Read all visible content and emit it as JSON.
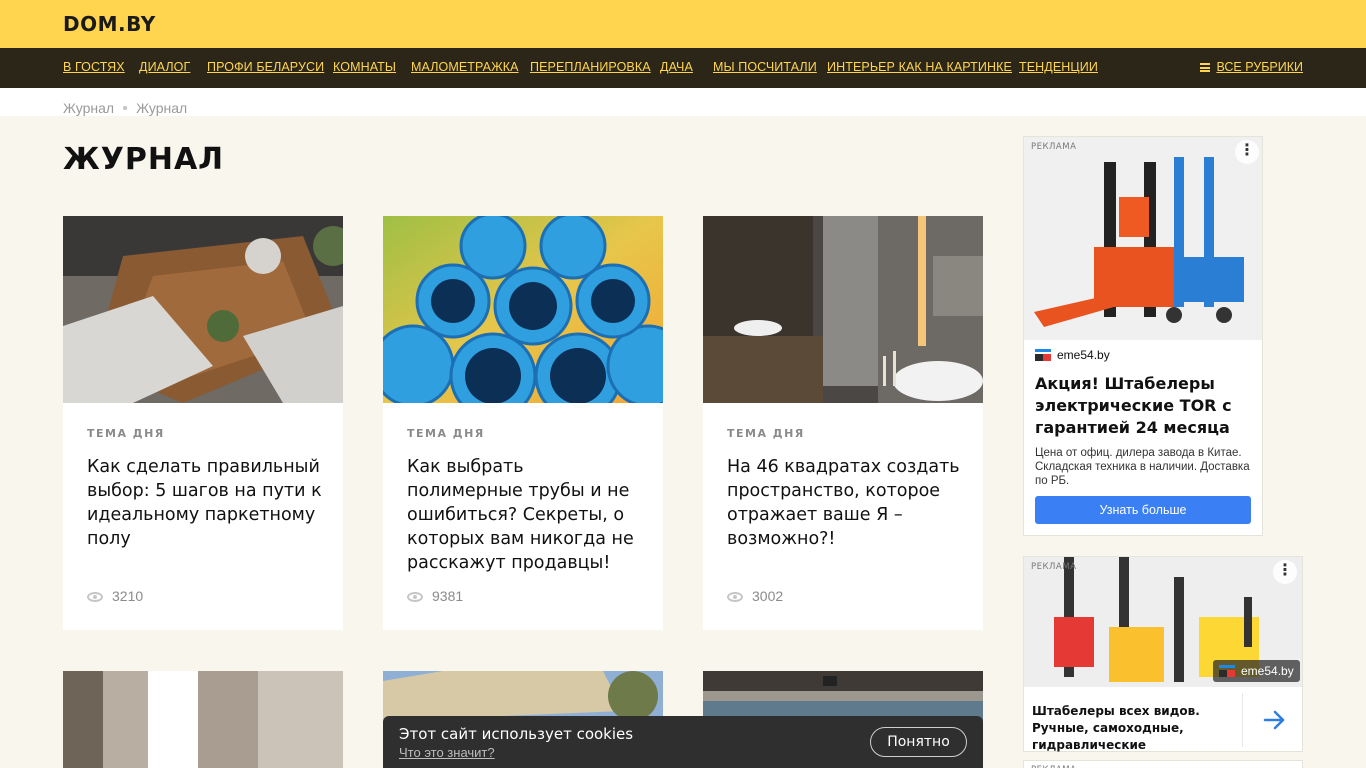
{
  "header": {
    "logo": "DOM.BY"
  },
  "nav": {
    "items": [
      "В ГОСТЯХ",
      "ДИАЛОГ",
      "ПРОФИ БЕЛАРУСИ",
      "КОМНАТЫ",
      "МАЛОМЕТРАЖКА",
      "ПЕРЕПЛАНИРОВКА",
      "ДАЧА",
      "МЫ ПОСЧИТАЛИ",
      "ИНТЕРЬЕР КАК НА КАРТИНКЕ",
      "ТЕНДЕНЦИИ"
    ],
    "all_rubrics": "ВСЕ РУБРИКИ"
  },
  "breadcrumbs": [
    "Журнал",
    "Журнал"
  ],
  "page_title": "ЖУРНАЛ",
  "cards": [
    {
      "rubric": "ТЕМА ДНЯ",
      "title": "Как сделать правильный выбор: 5 шагов на пути к идеальному паркетному полу",
      "views": "3210"
    },
    {
      "rubric": "ТЕМА ДНЯ",
      "title": "Как выбрать полимерные трубы и не ошибиться? Секреты, о которых вам никогда не расскажут продавцы!",
      "views": "9381"
    },
    {
      "rubric": "ТЕМА ДНЯ",
      "title": "На 46 квадратах создать пространство, которое отражает ваше Я – возможно?!",
      "views": "3002"
    }
  ],
  "ads": {
    "label": "РЕКЛАМА",
    "ad1": {
      "domain": "eme54.by",
      "headline": "Акция! Штабелеры электрические TOR с гарантией 24 месяца",
      "description": "Цена от офиц. дилера завода в Китае. Складская техника в наличии. Доставка по РБ.",
      "cta": "Узнать больше"
    },
    "ad2": {
      "domain": "eme54.by",
      "text": "Штабелеры всех видов. Ручные, самоходные, гидравлические"
    }
  },
  "cookie": {
    "message": "Этот сайт использует cookies",
    "link": "Что это значит?",
    "accept": "Понятно"
  },
  "colors": {
    "brand_yellow": "#ffd54f",
    "nav_dark": "#2b2618",
    "page_bg": "#f9f6ee",
    "ad_button": "#3b7ff5"
  },
  "icons": [
    "menu-icon",
    "eye-icon",
    "more-vertical-icon",
    "arrow-right-icon"
  ]
}
